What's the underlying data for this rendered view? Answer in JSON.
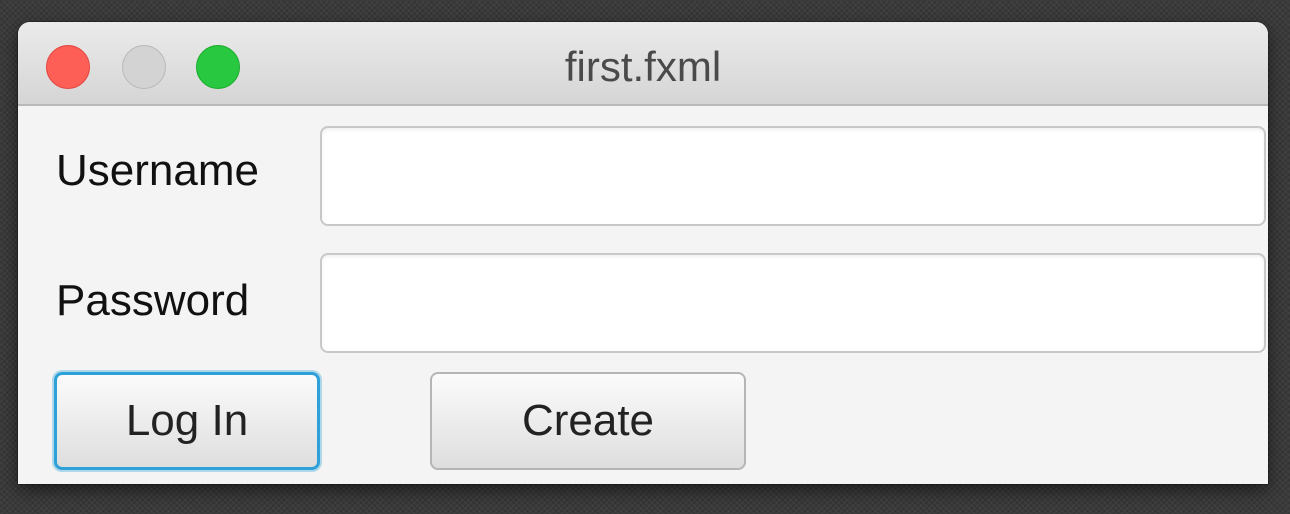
{
  "window": {
    "title": "first.fxml"
  },
  "form": {
    "username_label": "Username",
    "username_value": "",
    "password_label": "Password",
    "password_value": ""
  },
  "buttons": {
    "login_label": "Log In",
    "create_label": "Create"
  },
  "colors": {
    "focus_ring": "#2ea1d8",
    "close": "#fd5f57",
    "minimize": "#d3d3d3",
    "zoom": "#28c840"
  }
}
